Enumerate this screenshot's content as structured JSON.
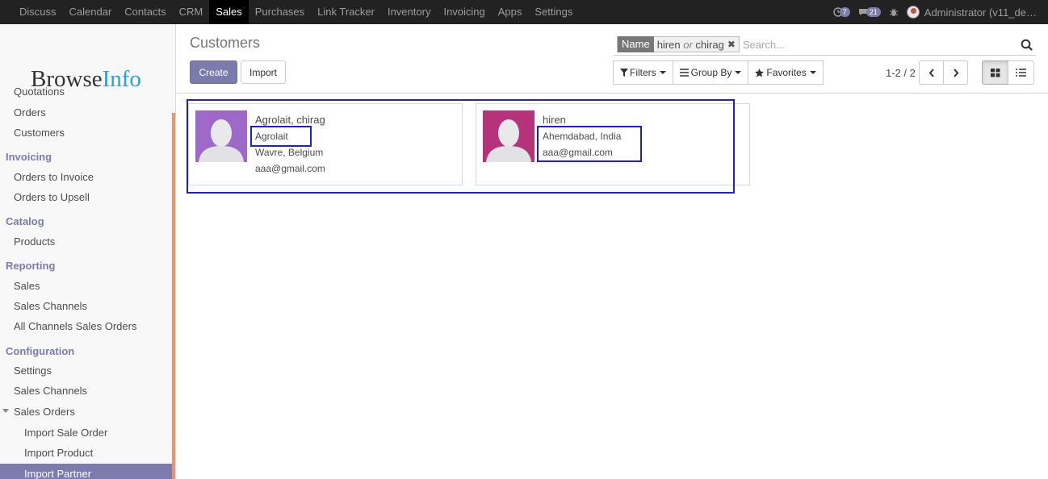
{
  "topbar": {
    "menu": [
      "Discuss",
      "Calendar",
      "Contacts",
      "CRM",
      "Sales",
      "Purchases",
      "Link Tracker",
      "Inventory",
      "Invoicing",
      "Apps",
      "Settings"
    ],
    "active": "Sales",
    "activity_count": "7",
    "message_count": "21",
    "user": "Administrator (v11_de…"
  },
  "sidebar": {
    "logo_main": "Browse",
    "logo_accent": "Info",
    "items": [
      {
        "type": "item",
        "label": "Quotations"
      },
      {
        "type": "item",
        "label": "Orders"
      },
      {
        "type": "item",
        "label": "Customers"
      },
      {
        "type": "section",
        "label": "Invoicing"
      },
      {
        "type": "item",
        "label": "Orders to Invoice"
      },
      {
        "type": "item",
        "label": "Orders to Upsell"
      },
      {
        "type": "section",
        "label": "Catalog"
      },
      {
        "type": "item",
        "label": "Products"
      },
      {
        "type": "section",
        "label": "Reporting"
      },
      {
        "type": "item",
        "label": "Sales"
      },
      {
        "type": "item",
        "label": "Sales Channels"
      },
      {
        "type": "item",
        "label": "All Channels Sales Orders"
      },
      {
        "type": "section",
        "label": "Configuration"
      },
      {
        "type": "item",
        "label": "Settings"
      },
      {
        "type": "item",
        "label": "Sales Channels"
      },
      {
        "type": "item",
        "label": "Sales Orders"
      },
      {
        "type": "sub",
        "label": "Import Sale Order"
      },
      {
        "type": "sub",
        "label": "Import Product"
      },
      {
        "type": "sub",
        "label": "Import Partner"
      }
    ]
  },
  "control_panel": {
    "title": "Customers",
    "create_label": "Create",
    "import_label": "Import",
    "search": {
      "facet_label": "Name",
      "facet_value_1": "hiren",
      "facet_or": "or",
      "facet_value_2": "chirag",
      "placeholder": "Search..."
    },
    "filters_label": "Filters",
    "groupby_label": "Group By",
    "favorites_label": "Favorites",
    "pager": "1-2 / 2"
  },
  "cards": [
    {
      "name": "Agrolait, chirag",
      "line1": "Agrolait",
      "line2": "Wavre, Belgium",
      "line3": "aaa@gmail.com",
      "avatar_color": "#9d6ac9"
    },
    {
      "name": "hiren",
      "line1": "Ahemdabad, India",
      "line2": "aaa@gmail.com",
      "line3": "",
      "avatar_color": "#b5337a"
    }
  ],
  "colors": {
    "brand": "#7c7bad",
    "navbar": "#222222",
    "accent_bar": "#f0936a",
    "annotation": "#1b1fd9"
  }
}
